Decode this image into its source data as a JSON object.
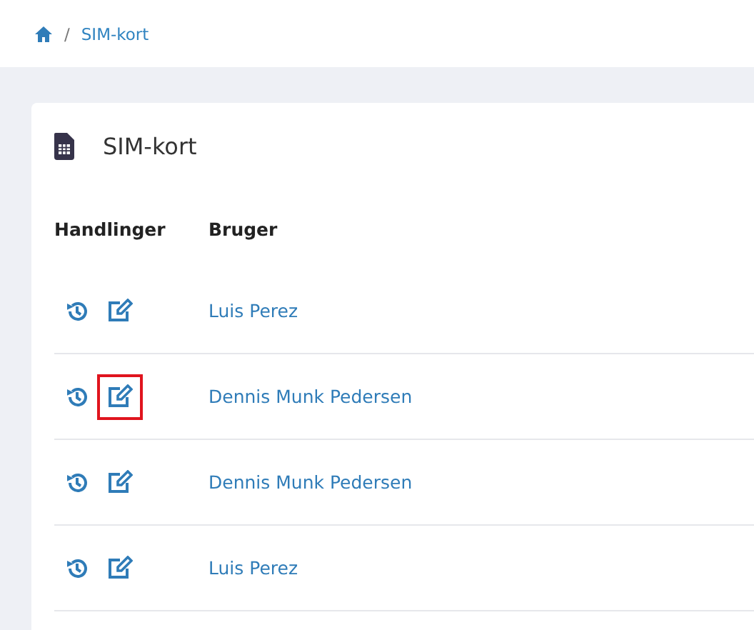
{
  "breadcrumb": {
    "separator": "/",
    "current": "SIM-kort"
  },
  "card": {
    "title": "SIM-kort"
  },
  "table": {
    "columns": [
      "Handlinger",
      "Bruger"
    ],
    "rows": [
      {
        "user": "Luis Perez",
        "highlighted": false
      },
      {
        "user": "Dennis Munk Pedersen",
        "highlighted": true
      },
      {
        "user": "Dennis Munk Pedersen",
        "highlighted": false
      },
      {
        "user": "Luis Perez",
        "highlighted": false
      }
    ]
  }
}
